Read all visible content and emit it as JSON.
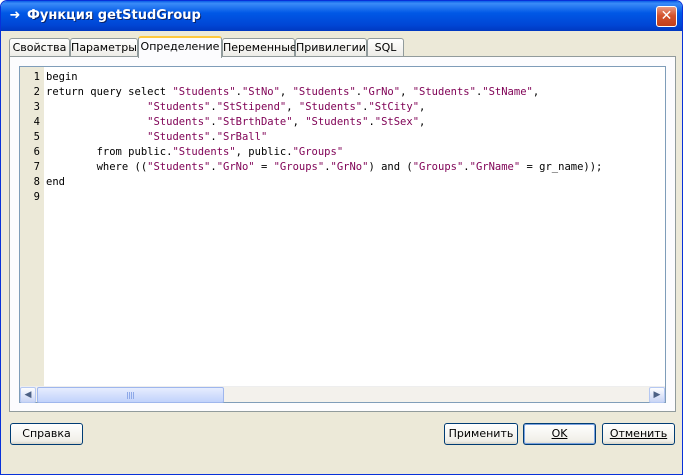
{
  "window": {
    "title": "Функция getStudGroup",
    "close_glyph": "✕"
  },
  "tabs": [
    {
      "label": "Свойства"
    },
    {
      "label": "Параметры"
    },
    {
      "label": "Определение",
      "active": true
    },
    {
      "label": "Переменные"
    },
    {
      "label": "Привилегии"
    },
    {
      "label": "SQL"
    }
  ],
  "editor": {
    "line_numbers": [
      "1",
      "2",
      "3",
      "4",
      "5",
      "6",
      "7",
      "8",
      "9"
    ],
    "lines": [
      "begin",
      "return query select \"Students\".\"StNo\", \"Students\".\"GrNo\", \"Students\".\"StName\",",
      "                \"Students\".\"StStipend\", \"Students\".\"StCity\",",
      "                \"Students\".\"StBrthDate\", \"Students\".\"StSex\",",
      "                \"Students\".\"SrBall\"",
      "        from public.\"Students\", public.\"Groups\"",
      "        where ((\"Students\".\"GrNo\" = \"Groups\".\"GrNo\") and (\"Groups\".\"GrName\" = gr_name));",
      "end",
      ""
    ],
    "string_color": "#7f0055"
  },
  "buttons": {
    "help": "Справка",
    "apply": "Применить",
    "ok": "OK",
    "cancel": "Отменить"
  },
  "colors": {
    "titlebar": "#0058e6",
    "dialog_bg": "#ece9d8",
    "tab_highlight": "#ffc83c"
  }
}
